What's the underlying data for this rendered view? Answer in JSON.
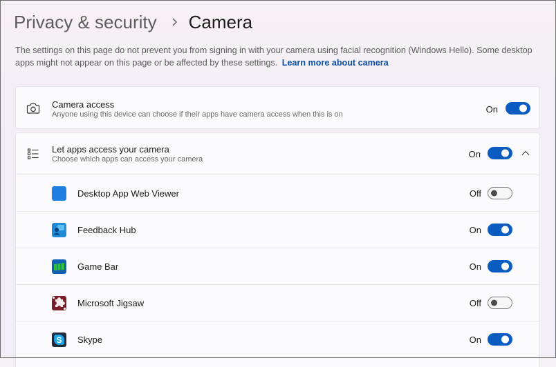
{
  "header": {
    "parent": "Privacy & security",
    "current": "Camera"
  },
  "description": {
    "text": "The settings on this page do not prevent you from signing in with your camera using facial recognition (Windows Hello). Some desktop apps might not appear on this page or be affected by these settings.",
    "link": "Learn more about camera"
  },
  "camera_access": {
    "title": "Camera access",
    "subtitle": "Anyone using this device can choose if their apps have camera access when this is on",
    "state_label": "On",
    "enabled": true,
    "icon": "camera-icon"
  },
  "let_apps": {
    "title": "Let apps access your camera",
    "subtitle": "Choose which apps can access your camera",
    "state_label": "On",
    "enabled": true,
    "icon": "list-icon",
    "expanded": true
  },
  "apps": [
    {
      "name": "Desktop App Web Viewer",
      "state_label": "Off",
      "enabled": false,
      "icon": "desktop-app-web-viewer-icon"
    },
    {
      "name": "Feedback Hub",
      "state_label": "On",
      "enabled": true,
      "icon": "feedback-hub-icon"
    },
    {
      "name": "Game Bar",
      "state_label": "On",
      "enabled": true,
      "icon": "game-bar-icon"
    },
    {
      "name": "Microsoft Jigsaw",
      "state_label": "Off",
      "enabled": false,
      "icon": "microsoft-jigsaw-icon"
    },
    {
      "name": "Skype",
      "state_label": "On",
      "enabled": true,
      "icon": "skype-icon"
    }
  ],
  "colors": {
    "accent": "#0b5cc0",
    "link": "#0b4f9e"
  }
}
